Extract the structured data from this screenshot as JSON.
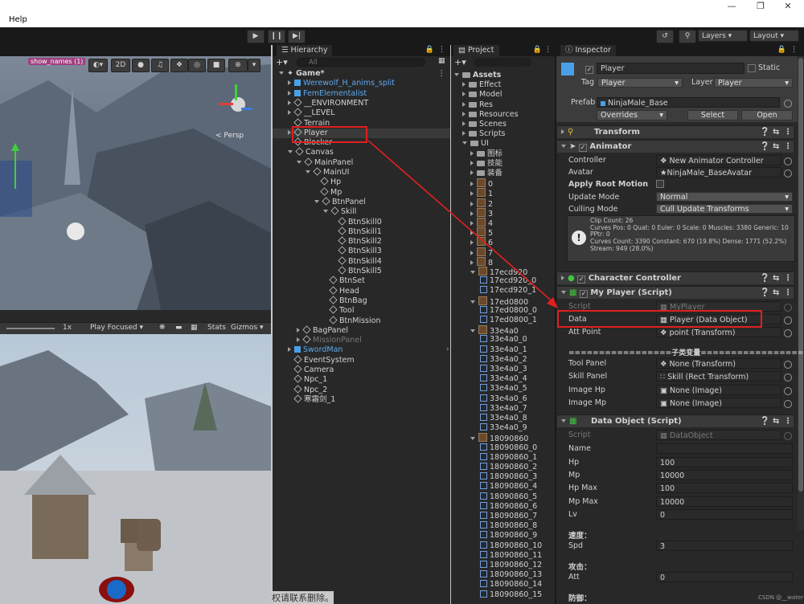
{
  "menubar": {
    "help": "Help"
  },
  "toolbar": {
    "layers": "Layers",
    "layout": "Layout"
  },
  "scene": {
    "mode_2d": "2D",
    "persp": "< Persp",
    "banner": "show_names (1)"
  },
  "game": {
    "scale": "1x",
    "play_focused": "Play Focused",
    "stats": "Stats",
    "gizmos": "Gizmos"
  },
  "hierarchy": {
    "tab": "Hierarchy",
    "search_placeholder": "All",
    "items": [
      {
        "label": "Game*",
        "depth": 0,
        "expanded": true,
        "kind": "scene"
      },
      {
        "label": "Werewolf_H_anims_split",
        "depth": 1,
        "kind": "prefab-blue",
        "collapsed": true
      },
      {
        "label": "FemElementalist",
        "depth": 1,
        "kind": "prefab-blue",
        "collapsed": true
      },
      {
        "label": "__ENVIRONMENT",
        "depth": 1,
        "kind": "obj",
        "collapsed": true
      },
      {
        "label": "__LEVEL",
        "depth": 1,
        "kind": "obj",
        "collapsed": true
      },
      {
        "label": "Terrain",
        "depth": 1,
        "kind": "obj"
      },
      {
        "label": "Player",
        "depth": 1,
        "kind": "obj",
        "collapsed": true,
        "selected": true
      },
      {
        "label": "Blocker",
        "depth": 1,
        "kind": "obj"
      },
      {
        "label": "Canvas",
        "depth": 1,
        "kind": "obj",
        "expanded": true
      },
      {
        "label": "MainPanel",
        "depth": 2,
        "kind": "obj",
        "expanded": true
      },
      {
        "label": "MainUI",
        "depth": 3,
        "kind": "obj",
        "expanded": true
      },
      {
        "label": "Hp",
        "depth": 4,
        "kind": "obj"
      },
      {
        "label": "Mp",
        "depth": 4,
        "kind": "obj"
      },
      {
        "label": "BtnPanel",
        "depth": 4,
        "kind": "obj",
        "expanded": true
      },
      {
        "label": "Skill",
        "depth": 5,
        "kind": "obj",
        "expanded": true
      },
      {
        "label": "BtnSkill0",
        "depth": 6,
        "kind": "obj"
      },
      {
        "label": "BtnSkill1",
        "depth": 6,
        "kind": "obj"
      },
      {
        "label": "BtnSkill2",
        "depth": 6,
        "kind": "obj"
      },
      {
        "label": "BtnSkill3",
        "depth": 6,
        "kind": "obj"
      },
      {
        "label": "BtnSkill4",
        "depth": 6,
        "kind": "obj"
      },
      {
        "label": "BtnSkill5",
        "depth": 6,
        "kind": "obj"
      },
      {
        "label": "BtnSet",
        "depth": 5,
        "kind": "obj"
      },
      {
        "label": "Head",
        "depth": 5,
        "kind": "obj"
      },
      {
        "label": "BtnBag",
        "depth": 5,
        "kind": "obj"
      },
      {
        "label": "Tool",
        "depth": 5,
        "kind": "obj"
      },
      {
        "label": "BtnMission",
        "depth": 5,
        "kind": "obj"
      },
      {
        "label": "BagPanel",
        "depth": 2,
        "kind": "obj",
        "collapsed": true
      },
      {
        "label": "MissionPanel",
        "depth": 2,
        "kind": "obj-dim",
        "collapsed": true
      },
      {
        "label": "SwordMan",
        "depth": 1,
        "kind": "prefab-blue",
        "collapsed": true
      },
      {
        "label": "EventSystem",
        "depth": 1,
        "kind": "obj"
      },
      {
        "label": "Camera",
        "depth": 1,
        "kind": "obj"
      },
      {
        "label": "Npc_1",
        "depth": 1,
        "kind": "obj"
      },
      {
        "label": "Npc_2",
        "depth": 1,
        "kind": "obj"
      },
      {
        "label": "寒霜剑_1",
        "depth": 1,
        "kind": "obj"
      }
    ]
  },
  "project": {
    "tab": "Project",
    "items": [
      {
        "label": "Assets",
        "depth": 0,
        "kind": "folder",
        "expanded": true
      },
      {
        "label": "Effect",
        "depth": 1,
        "kind": "folder"
      },
      {
        "label": "Model",
        "depth": 1,
        "kind": "folder"
      },
      {
        "label": "Res",
        "depth": 1,
        "kind": "folder"
      },
      {
        "label": "Resources",
        "depth": 1,
        "kind": "folder"
      },
      {
        "label": "Scenes",
        "depth": 1,
        "kind": "folder"
      },
      {
        "label": "Scripts",
        "depth": 1,
        "kind": "folder"
      },
      {
        "label": "UI",
        "depth": 1,
        "kind": "folder",
        "expanded": true
      },
      {
        "label": "图标",
        "depth": 2,
        "kind": "folder"
      },
      {
        "label": "技能",
        "depth": 2,
        "kind": "folder"
      },
      {
        "label": "装备",
        "depth": 2,
        "kind": "folder"
      },
      {
        "label": "0",
        "depth": 2,
        "kind": "img"
      },
      {
        "label": "1",
        "depth": 2,
        "kind": "img"
      },
      {
        "label": "2",
        "depth": 2,
        "kind": "img"
      },
      {
        "label": "3",
        "depth": 2,
        "kind": "img"
      },
      {
        "label": "4",
        "depth": 2,
        "kind": "img"
      },
      {
        "label": "5",
        "depth": 2,
        "kind": "img"
      },
      {
        "label": "6",
        "depth": 2,
        "kind": "img"
      },
      {
        "label": "7",
        "depth": 2,
        "kind": "img"
      },
      {
        "label": "8",
        "depth": 2,
        "kind": "img"
      },
      {
        "label": "17ecd920",
        "depth": 2,
        "kind": "img",
        "expanded": true
      },
      {
        "label": "17ecd920_0",
        "depth": 3,
        "kind": "sub"
      },
      {
        "label": "17ecd920_1",
        "depth": 3,
        "kind": "sub"
      },
      {
        "label": "17ed0800",
        "depth": 2,
        "kind": "img",
        "expanded": true
      },
      {
        "label": "17ed0800_0",
        "depth": 3,
        "kind": "sub"
      },
      {
        "label": "17ed0800_1",
        "depth": 3,
        "kind": "sub"
      },
      {
        "label": "33e4a0",
        "depth": 2,
        "kind": "img",
        "expanded": true
      },
      {
        "label": "33e4a0_0",
        "depth": 3,
        "kind": "sub"
      },
      {
        "label": "33e4a0_1",
        "depth": 3,
        "kind": "sub"
      },
      {
        "label": "33e4a0_2",
        "depth": 3,
        "kind": "sub"
      },
      {
        "label": "33e4a0_3",
        "depth": 3,
        "kind": "sub"
      },
      {
        "label": "33e4a0_4",
        "depth": 3,
        "kind": "sub"
      },
      {
        "label": "33e4a0_5",
        "depth": 3,
        "kind": "sub"
      },
      {
        "label": "33e4a0_6",
        "depth": 3,
        "kind": "sub"
      },
      {
        "label": "33e4a0_7",
        "depth": 3,
        "kind": "sub"
      },
      {
        "label": "33e4a0_8",
        "depth": 3,
        "kind": "sub"
      },
      {
        "label": "33e4a0_9",
        "depth": 3,
        "kind": "sub"
      },
      {
        "label": "18090860",
        "depth": 2,
        "kind": "img",
        "expanded": true
      },
      {
        "label": "18090860_0",
        "depth": 3,
        "kind": "sub"
      },
      {
        "label": "18090860_1",
        "depth": 3,
        "kind": "sub"
      },
      {
        "label": "18090860_2",
        "depth": 3,
        "kind": "sub"
      },
      {
        "label": "18090860_3",
        "depth": 3,
        "kind": "sub"
      },
      {
        "label": "18090860_4",
        "depth": 3,
        "kind": "sub"
      },
      {
        "label": "18090860_5",
        "depth": 3,
        "kind": "sub"
      },
      {
        "label": "18090860_6",
        "depth": 3,
        "kind": "sub"
      },
      {
        "label": "18090860_7",
        "depth": 3,
        "kind": "sub"
      },
      {
        "label": "18090860_8",
        "depth": 3,
        "kind": "sub"
      },
      {
        "label": "18090860_9",
        "depth": 3,
        "kind": "sub"
      },
      {
        "label": "18090860_10",
        "depth": 3,
        "kind": "sub"
      },
      {
        "label": "18090860_11",
        "depth": 3,
        "kind": "sub"
      },
      {
        "label": "18090860_12",
        "depth": 3,
        "kind": "sub"
      },
      {
        "label": "18090860_13",
        "depth": 3,
        "kind": "sub"
      },
      {
        "label": "18090860_14",
        "depth": 3,
        "kind": "sub"
      },
      {
        "label": "18090860_15",
        "depth": 3,
        "kind": "sub"
      }
    ]
  },
  "inspector": {
    "tab": "Inspector",
    "name": "Player",
    "static": "Static",
    "tag_label": "Tag",
    "tag_value": "Player",
    "layer_label": "Layer",
    "layer_value": "Player",
    "prefab_label": "Prefab",
    "prefab_value": "NinjaMale_Base",
    "overrides": "Overrides",
    "select": "Select",
    "open": "Open",
    "transform": "Transform",
    "animator": "Animator",
    "controller_label": "Controller",
    "controller_value": "New Animator Controller",
    "avatar_label": "Avatar",
    "avatar_value": "NinjaMale_BaseAvatar",
    "apply_root_motion": "Apply Root Motion",
    "update_mode_label": "Update Mode",
    "update_mode_value": "Normal",
    "culling_mode_label": "Culling Mode",
    "culling_mode_value": "Cull Update Transforms",
    "info_line1": "Clip Count: 26",
    "info_line2": "Curves Pos: 0 Quat: 0 Euler: 0 Scale: 0 Muscles: 3380 Generic: 10",
    "info_line3": "PPtr: 0",
    "info_line4": "Curves Count: 3390 Constant: 670 (19.8%) Dense: 1771 (52.2%)",
    "info_line5": "Stream: 949 (28.0%)",
    "character_controller": "Character Controller",
    "my_player": "My Player (Script)",
    "script_label": "Script",
    "script_myplayer": "MyPlayer",
    "data_label": "Data",
    "data_value": "Player (Data Object)",
    "att_point_label": "Att Point",
    "att_point_value": "point (Transform)",
    "child_header": "=================子类变量=================",
    "tool_panel_label": "Tool Panel",
    "tool_panel_value": "None (Transform)",
    "skill_panel_label": "Skill Panel",
    "skill_panel_value": "Skill (Rect Transform)",
    "image_hp_label": "Image Hp",
    "image_hp_value": "None (Image)",
    "image_mp_label": "Image Mp",
    "image_mp_value": "None (Image)",
    "data_object": "Data Object (Script)",
    "script_dataobject": "DataObject",
    "name_label": "Name",
    "name_value": "",
    "hp_label": "Hp",
    "hp_value": "100",
    "mp_label": "Mp",
    "mp_value": "10000",
    "hpmax_label": "Hp Max",
    "hpmax_value": "100",
    "mpmax_label": "Mp Max",
    "mpmax_value": "10000",
    "lv_label": "Lv",
    "lv_value": "0",
    "speed_header": "速度：",
    "spd_label": "Spd",
    "spd_value": "3",
    "attack_header": "攻击：",
    "att_label": "Att",
    "att_value": "0",
    "defense_header": "防御："
  },
  "watermark": "CSDN @__water",
  "overlay_text": "权请联系删除。",
  "colors": {
    "annotation": "#e02020",
    "selection": "#2c5d87",
    "prefab": "#5fa8ee"
  }
}
